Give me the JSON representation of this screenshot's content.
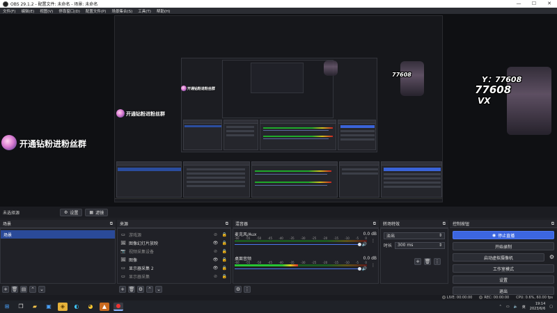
{
  "window": {
    "title": "OBS 29.1.2 - 配置文件: 未命名 - 场景: 未命名",
    "controls": [
      "—",
      "☐",
      "✕"
    ]
  },
  "menu": [
    "文件(F)",
    "编辑(E)",
    "视图(V)",
    "停靠窗口(D)",
    "配置文件(P)",
    "场景集合(S)",
    "工具(T)",
    "帮助(H)"
  ],
  "preview": {
    "promo_text": "开通钻粉进粉丝群",
    "watermark": {
      "line1": "Y：77608",
      "line2": "77608",
      "line3": "VX"
    }
  },
  "status_row": {
    "label": "未选择源",
    "properties_label": "设置",
    "filters_label": "滤镜"
  },
  "scenes": {
    "title": "场景",
    "items": [
      "场景"
    ]
  },
  "sources": {
    "title": "来源",
    "items": [
      {
        "icon": "▭",
        "name": "游戏源",
        "visible": "⊘",
        "locked": "🔒",
        "dim": true
      },
      {
        "icon": "🖼",
        "name": "图像幻灯片放映",
        "visible": "👁",
        "locked": "🔒",
        "dim": false
      },
      {
        "icon": "📷",
        "name": "视频采集设备",
        "visible": "⊘",
        "locked": "🔒",
        "dim": true
      },
      {
        "icon": "🖼",
        "name": "图像",
        "visible": "👁",
        "locked": "🔒",
        "dim": false
      },
      {
        "icon": "▭",
        "name": "显示器采集 2",
        "visible": "👁",
        "locked": "🔒",
        "dim": false
      },
      {
        "icon": "▭",
        "name": "显示器采集",
        "visible": "⊘",
        "locked": "🔒",
        "dim": true
      }
    ]
  },
  "mixer": {
    "title": "混音器",
    "scale": [
      "-60",
      "-55",
      "-50",
      "-45",
      "-40",
      "-35",
      "-30",
      "-25",
      "-20",
      "-15",
      "-10",
      "-5",
      "0"
    ],
    "channels": [
      {
        "name": "麦克风/Aux",
        "db": "0.0 dB",
        "level": 0.0
      },
      {
        "name": "桌面音频",
        "db": "0.0 dB",
        "level": 0.48
      }
    ]
  },
  "transitions": {
    "title": "转场特效",
    "type": "淡出",
    "duration_label": "时长",
    "duration": "300 ms"
  },
  "controls": {
    "title": "控制按钮",
    "buttons": [
      "停止直播",
      "开始录制",
      "启动虚拟摄像机",
      "工作室模式",
      "设置",
      "退出"
    ]
  },
  "obs_status": {
    "live": "LIVE: 00:00:00",
    "rec": "REC: 00:00:00",
    "cpu": "CPU: 0.6%, 60.00 fps"
  },
  "taskbar": {
    "time": "19:14",
    "date": "2023/6/6"
  },
  "colors": {
    "accent": "#3c66e0",
    "selected": "#2a4a98",
    "meter_green": "#27c433",
    "meter_yellow": "#e1d21d",
    "meter_red": "#df2a2a"
  }
}
